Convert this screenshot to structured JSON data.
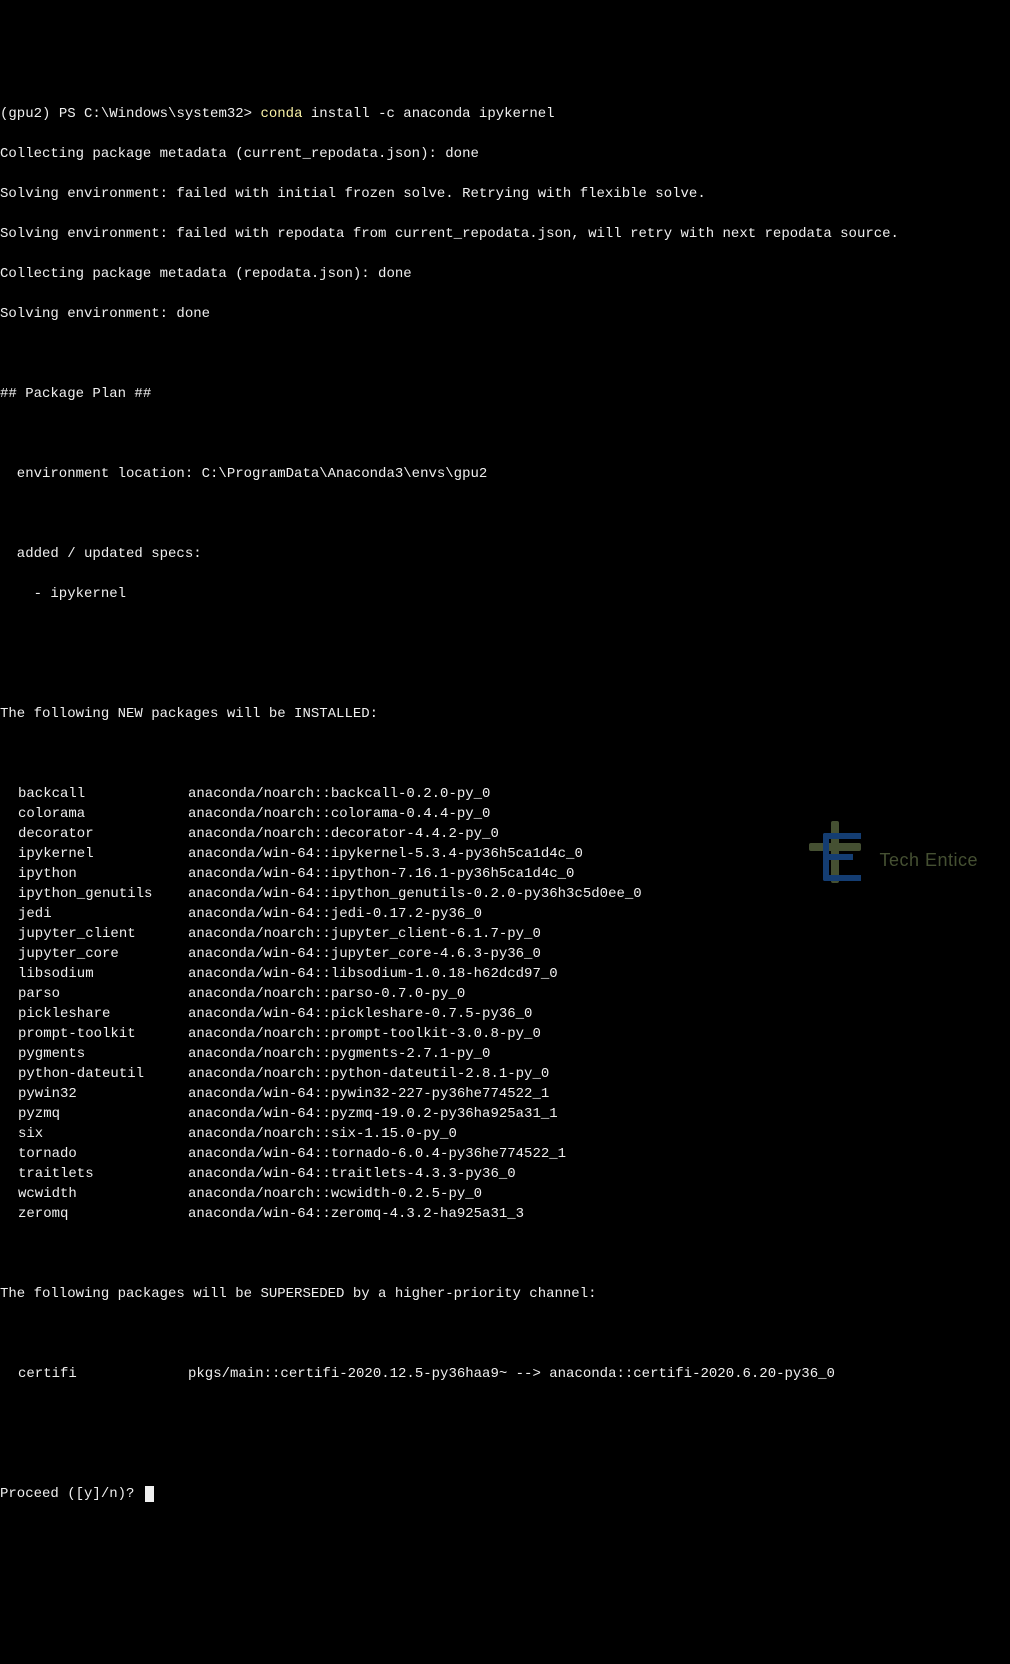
{
  "prompt": {
    "env": "(gpu2) ",
    "ps": "PS ",
    "path": "C:\\Windows\\system32> ",
    "cmd_word": "conda",
    "cmd_rest": " install -c anaconda ipykernel"
  },
  "lines": {
    "collect1": "Collecting package metadata (current_repodata.json): done",
    "solve1": "Solving environment: failed with initial frozen solve. Retrying with flexible solve.",
    "solve2": "Solving environment: failed with repodata from current_repodata.json, will retry with next repodata source.",
    "collect2": "Collecting package metadata (repodata.json): done",
    "solve3": "Solving environment: done",
    "plan": "## Package Plan ##",
    "envloc": "  environment location: C:\\ProgramData\\Anaconda3\\envs\\gpu2",
    "added": "  added / updated specs:",
    "spec": "    - ipykernel",
    "newpkgs": "The following NEW packages will be INSTALLED:",
    "superseded": "The following packages will be SUPERSEDED by a higher-priority channel:",
    "proceed": "Proceed ([y]/n)? "
  },
  "packages": [
    {
      "name": "backcall",
      "detail": "anaconda/noarch::backcall-0.2.0-py_0"
    },
    {
      "name": "colorama",
      "detail": "anaconda/noarch::colorama-0.4.4-py_0"
    },
    {
      "name": "decorator",
      "detail": "anaconda/noarch::decorator-4.4.2-py_0"
    },
    {
      "name": "ipykernel",
      "detail": "anaconda/win-64::ipykernel-5.3.4-py36h5ca1d4c_0"
    },
    {
      "name": "ipython",
      "detail": "anaconda/win-64::ipython-7.16.1-py36h5ca1d4c_0"
    },
    {
      "name": "ipython_genutils",
      "detail": "anaconda/win-64::ipython_genutils-0.2.0-py36h3c5d0ee_0"
    },
    {
      "name": "jedi",
      "detail": "anaconda/win-64::jedi-0.17.2-py36_0"
    },
    {
      "name": "jupyter_client",
      "detail": "anaconda/noarch::jupyter_client-6.1.7-py_0"
    },
    {
      "name": "jupyter_core",
      "detail": "anaconda/win-64::jupyter_core-4.6.3-py36_0"
    },
    {
      "name": "libsodium",
      "detail": "anaconda/win-64::libsodium-1.0.18-h62dcd97_0"
    },
    {
      "name": "parso",
      "detail": "anaconda/noarch::parso-0.7.0-py_0"
    },
    {
      "name": "pickleshare",
      "detail": "anaconda/win-64::pickleshare-0.7.5-py36_0"
    },
    {
      "name": "prompt-toolkit",
      "detail": "anaconda/noarch::prompt-toolkit-3.0.8-py_0"
    },
    {
      "name": "pygments",
      "detail": "anaconda/noarch::pygments-2.7.1-py_0"
    },
    {
      "name": "python-dateutil",
      "detail": "anaconda/noarch::python-dateutil-2.8.1-py_0"
    },
    {
      "name": "pywin32",
      "detail": "anaconda/win-64::pywin32-227-py36he774522_1"
    },
    {
      "name": "pyzmq",
      "detail": "anaconda/win-64::pyzmq-19.0.2-py36ha925a31_1"
    },
    {
      "name": "six",
      "detail": "anaconda/noarch::six-1.15.0-py_0"
    },
    {
      "name": "tornado",
      "detail": "anaconda/win-64::tornado-6.0.4-py36he774522_1"
    },
    {
      "name": "traitlets",
      "detail": "anaconda/win-64::traitlets-4.3.3-py36_0"
    },
    {
      "name": "wcwidth",
      "detail": "anaconda/noarch::wcwidth-0.2.5-py_0"
    },
    {
      "name": "zeromq",
      "detail": "anaconda/win-64::zeromq-4.3.2-ha925a31_3"
    }
  ],
  "superseded_pkg": {
    "name": "certifi",
    "detail": "pkgs/main::certifi-2020.12.5-py36haa9~ --> anaconda::certifi-2020.6.20-py36_0"
  },
  "watermark": {
    "text": "Tech Entice"
  }
}
